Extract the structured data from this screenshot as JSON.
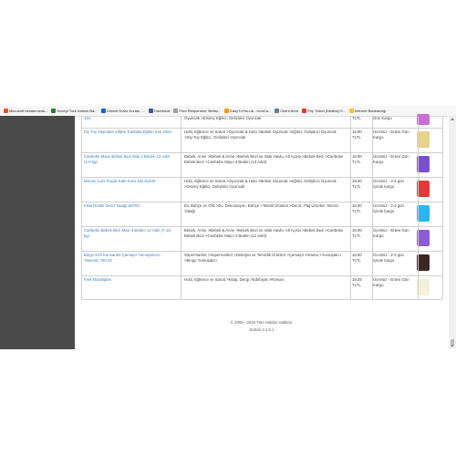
{
  "bookmarks": [
    {
      "label": "Microsoft hesabınızda...",
      "color": "#f25022"
    },
    {
      "label": "Kuveyt Türk Katılım Ba...",
      "color": "#2e7d32"
    },
    {
      "label": "Güncel Döviz Kurları, ...",
      "color": "#1565c0"
    },
    {
      "label": "Facebook",
      "color": "#3b5998"
    },
    {
      "label": "Free Responsive Websi...",
      "color": "#9e9e9e"
    },
    {
      "label": "EasyTvYou.ua - IconCa...",
      "color": "#ff9800"
    },
    {
      "label": "Client Area",
      "color": "#607d8b"
    },
    {
      "label": "Php Ticket (Destek) S...",
      "color": "#e53935"
    },
    {
      "label": "İnternet Bankacılığı",
      "color": "#fbc02d"
    }
  ],
  "products": [
    {
      "name": "124",
      "category": "Oyuncak >Disney Eğitici, Geliştirici Oyuncak",
      "price": "TLTL",
      "shipping": "Gün Kargo",
      "thumb_color": "#c86dd7"
    },
    {
      "name": "Diy Toy Yaşından Alfabe Tombala Eğitim Seti 2004",
      "category": "Hobi, Eğlence ve Sanat >Oyuncak & Hobi >Bebek Oyuncak >Eğitici, Geliştirici Oyuncak >Diy-Toy Eğitici, Geliştirici Oyuncak",
      "price": "19,90 TLTL",
      "shipping": "Ücretsiz - Ertesi Gün Kargo",
      "thumb_color": "#e6d38a"
    },
    {
      "name": "Canbebe Mavo Bebek Bezi Midi 3 Beden 13 Adet (4-9 kg)",
      "category": "Bebek, Anne >Bebek & Anne >Bebek Bezi ve Islak Havlu, Alt Açma >Bebek Bezi >Canbebe Bebek Bezi >Canbebe Mayo 3 Beden (13 Adet)",
      "price": "18,90 TLTL",
      "shipping": "Ücretsiz - Ertesi Gün Kargo",
      "thumb_color": "#7a4fd0"
    },
    {
      "name": "Disney Cars Küçük Kale-Kova Set 01349",
      "category": "Hobi, Eğlence ve Sanat >Oyuncak & Hobi >Bebek Oyuncak >Eğitici, Geliştirici Oyuncak >Disney Eğitici, Geliştirici Oyuncak",
      "price": "18,90 TLTL",
      "shipping": "Ücretsiz - 2-3 gün içinde kargo",
      "thumb_color": "#e53935"
    },
    {
      "name": "İnkei Renkli Deniz Yatağı 59703",
      "category": "Ev, Bahçe ve Ofis >Ev, Dekorasyon, Bahçe >Tekstil Ürünleri >Deniz, Plaj Ürünleri >Deniz Yatağı",
      "price": "18,90 TLTL",
      "shipping": "Ücretsiz - 2-3 gün içinde kargo",
      "thumb_color": "#29b6f6"
    },
    {
      "name": "Canbebe Bebek Bezi Maxi 4 Beden 12 Adet (7-18 kg)",
      "category": "Bebek, Anne >Bebek & Anne >Bebek Bezi ve Islak Havlu, Alt Açma >Bebek Bezi >Canbebe Bebek Bezi >Canbebe Mayo 4 Beden (12 Adet)",
      "price": "18,90 TLTL",
      "shipping": "Ücretsiz - Ertesi Gün Kargo",
      "thumb_color": "#8e5ad6"
    },
    {
      "name": "Bingo Soft Konsantre Çamaşır Yumuşatıcısı Yasemin 750 ml",
      "category": "Süpermarket >Süpermarket >Deterjan ve Temizlik Ürünleri >Çamaşır Yıkama >Yumuşatıcı >Bingo Yumuşatıcı",
      "price": "18,90 TLTL",
      "shipping": "Ücretsiz - 2-3 gün içinde kargo",
      "thumb_color": "#3e2723"
    },
    {
      "name": "Feel Mastitiplan",
      "category": "Hobi, Eğlence ve Sanat >Kitap, Dergi >Edebiyat >Roman",
      "price": "19,05 TLTL",
      "shipping": "Ücretsiz - Ertesi Gün Kargo",
      "thumb_color": "#f5f1d8"
    }
  ],
  "footer": {
    "copyright": "© 2009 - 2018 Tüm Hakları Saklıdır.",
    "version": "Sürüm 2.1.0.1"
  }
}
